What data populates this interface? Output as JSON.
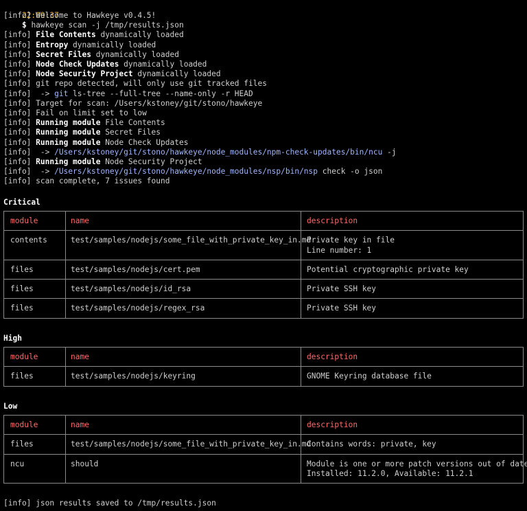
{
  "command": {
    "timestamp": "22:09:37",
    "prompt": "$",
    "text": " hawkeye scan -j /tmp/results.json"
  },
  "log": [
    {
      "prefix": "[info] ",
      "bold": "",
      "rest": "Welcome to Hawkeye v0.4.5!"
    },
    {
      "blank": true
    },
    {
      "prefix": "[info] ",
      "bold": "File Contents",
      "rest": " dynamically loaded"
    },
    {
      "prefix": "[info] ",
      "bold": "Entropy",
      "rest": " dynamically loaded"
    },
    {
      "prefix": "[info] ",
      "bold": "Secret Files",
      "rest": " dynamically loaded"
    },
    {
      "prefix": "[info] ",
      "bold": "Node Check Updates",
      "rest": " dynamically loaded"
    },
    {
      "prefix": "[info] ",
      "bold": "Node Security Project",
      "rest": " dynamically loaded"
    },
    {
      "prefix": "[info] ",
      "bold": "",
      "rest": "git repo detected, will only use git tracked files"
    },
    {
      "prefix": "[info]  -> ",
      "path": "git",
      "rest": " ls-tree --full-tree --name-only -r HEAD"
    },
    {
      "prefix": "[info] ",
      "bold": "",
      "rest": "Target for scan: /Users/kstoney/git/stono/hawkeye"
    },
    {
      "prefix": "[info] ",
      "bold": "",
      "rest": "Fail on limit set to low"
    },
    {
      "prefix": "[info] ",
      "bold": "Running module",
      "rest": " File Contents"
    },
    {
      "prefix": "[info] ",
      "bold": "Running module",
      "rest": " Secret Files"
    },
    {
      "prefix": "[info] ",
      "bold": "Running module",
      "rest": " Node Check Updates"
    },
    {
      "prefix": "[info]  -> ",
      "path": "/Users/kstoney/git/stono/hawkeye/node_modules/npm-check-updates/bin/ncu",
      "rest": " -j"
    },
    {
      "prefix": "[info] ",
      "bold": "Running module",
      "rest": " Node Security Project"
    },
    {
      "prefix": "[info]  -> ",
      "path": "/Users/kstoney/git/stono/hawkeye/node_modules/nsp/bin/nsp",
      "rest": " check -o json"
    },
    {
      "prefix": "[info] ",
      "bold": "",
      "rest": "scan complete, 7 issues found"
    }
  ],
  "columns": {
    "module": "module",
    "name": "name",
    "description": "description"
  },
  "sections": [
    {
      "title": "Critical",
      "rows": [
        {
          "module": "contents",
          "name": "test/samples/nodejs/some_file_with_private_key_in.md",
          "description": [
            "Private key in file",
            "Line number: 1"
          ]
        },
        {
          "module": "files",
          "name": "test/samples/nodejs/cert.pem",
          "description": [
            "Potential cryptographic private key"
          ]
        },
        {
          "module": "files",
          "name": "test/samples/nodejs/id_rsa",
          "description": [
            "Private SSH key"
          ]
        },
        {
          "module": "files",
          "name": "test/samples/nodejs/regex_rsa",
          "description": [
            "Private SSH key"
          ]
        }
      ]
    },
    {
      "title": "High",
      "rows": [
        {
          "module": "files",
          "name": "test/samples/nodejs/keyring",
          "description": [
            "GNOME Keyring database file"
          ]
        }
      ]
    },
    {
      "title": "Low",
      "rows": [
        {
          "module": "files",
          "name": "test/samples/nodejs/some_file_with_private_key_in.md",
          "description": [
            "Contains words: private, key"
          ]
        },
        {
          "module": "ncu",
          "name": "should",
          "description": [
            "Module is one or more patch versions out of date",
            "Installed: 11.2.0, Available: 11.2.1"
          ]
        }
      ]
    }
  ],
  "footer": "[info] json results saved to /tmp/results.json"
}
